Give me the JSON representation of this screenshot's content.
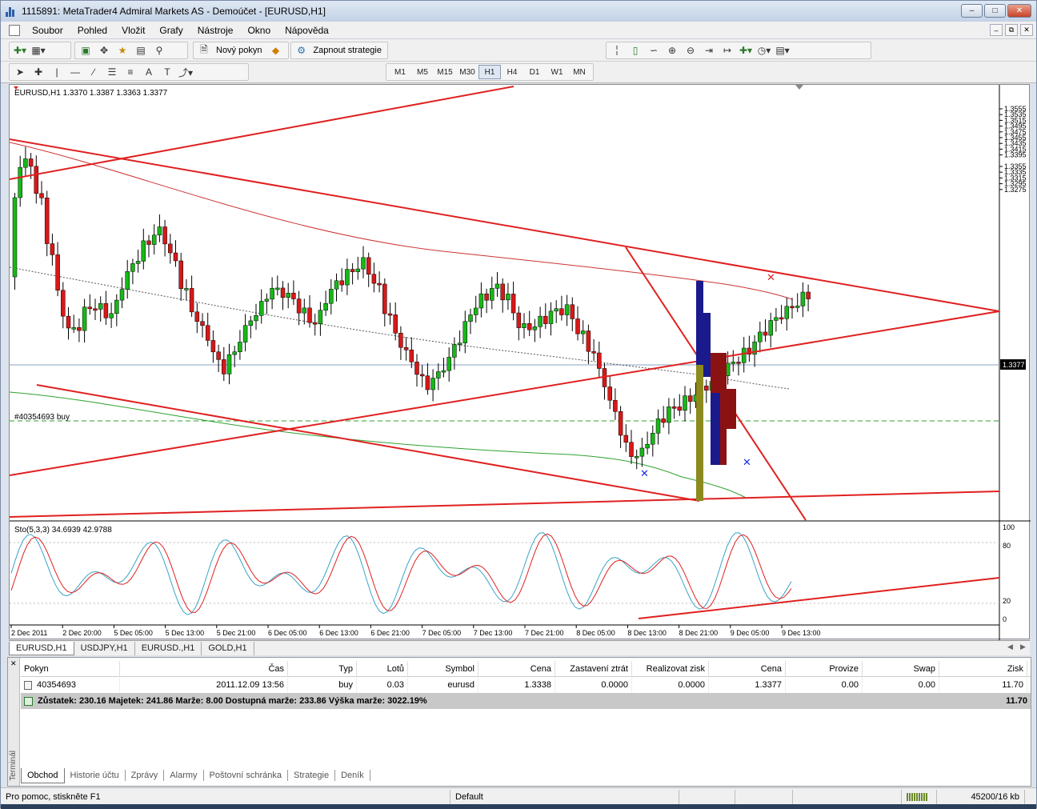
{
  "window": {
    "title": "1115891: MetaTrader4 Admiral Markets AS - Demoúčet - [EURUSD,H1]"
  },
  "menu": [
    "Soubor",
    "Pohled",
    "Vložit",
    "Grafy",
    "Nástroje",
    "Okno",
    "Nápověda"
  ],
  "toolbar": {
    "new_order": "Nový pokyn",
    "strategy": "Zapnout strategie"
  },
  "timeframes": [
    "M1",
    "M5",
    "M15",
    "M30",
    "H1",
    "H4",
    "D1",
    "W1",
    "MN"
  ],
  "timeframe_selected": "H1",
  "chart": {
    "header": "EURUSD,H1  1.3370 1.3387 1.3363 1.3377",
    "order_label": "#40354693 buy",
    "current_price": "1.3377",
    "price_ticks": [
      "1.3555",
      "1.3535",
      "1.3515",
      "1.3495",
      "1.3475",
      "1.3455",
      "1.3435",
      "1.3415",
      "1.3395",
      "1.3355",
      "1.3335",
      "1.3315",
      "1.3295",
      "1.3275"
    ],
    "stoch_header": "Sto(5,3,3) 34.6939 42.9788",
    "stoch_ticks": [
      "100",
      "80",
      "20",
      "0"
    ],
    "time_ticks": [
      "2 Dec 2011",
      "2 Dec 20:00",
      "5 Dec 05:00",
      "5 Dec 13:00",
      "5 Dec 21:00",
      "6 Dec 05:00",
      "6 Dec 13:00",
      "6 Dec 21:00",
      "7 Dec 05:00",
      "7 Dec 13:00",
      "7 Dec 21:00",
      "8 Dec 05:00",
      "8 Dec 13:00",
      "8 Dec 21:00",
      "9 Dec 05:00",
      "9 Dec 13:00"
    ]
  },
  "chart_data": {
    "type": "candlestick",
    "symbol": "EURUSD",
    "timeframe": "H1",
    "last_bar": {
      "open": 1.337,
      "high": 1.3387,
      "low": 1.3363,
      "close": 1.3377
    },
    "ylim": [
      1.327,
      1.357
    ],
    "stochastic": {
      "params": "5,3,3",
      "main": 34.6939,
      "signal": 42.9788,
      "levels": [
        20,
        80
      ],
      "ylim": [
        0,
        100
      ]
    }
  },
  "chart_tabs": [
    "EURUSD,H1",
    "USDJPY,H1",
    "EURUSD.,H1",
    "GOLD,H1"
  ],
  "terminal": {
    "columns": [
      "Pokyn",
      "Čas",
      "Typ",
      "Lotů",
      "Symbol",
      "Cena",
      "Zastavení ztrát",
      "Realizovat zisk",
      "Cena",
      "Provize",
      "Swap",
      "Zisk"
    ],
    "order": {
      "ticket": "40354693",
      "time": "2011.12.09 13:56",
      "type": "buy",
      "lots": "0.03",
      "symbol": "eurusd",
      "price": "1.3338",
      "sl": "0.0000",
      "tp": "0.0000",
      "current": "1.3377",
      "commission": "0.00",
      "swap": "0.00",
      "profit": "11.70"
    },
    "balance_line": "Zůstatek: 230.16  Majetek: 241.86  Marže: 8.00  Dostupná marže: 233.86  Výška marže: 3022.19%",
    "balance_profit": "11.70",
    "tabs": [
      "Obchod",
      "Historie účtu",
      "Zprávy",
      "Alarmy",
      "Poštovní schránka",
      "Strategie",
      "Deník"
    ],
    "side_label": "Terminál"
  },
  "status": {
    "help": "Pro pomoc, stiskněte F1",
    "profile": "Default",
    "traffic": "45200/16 kb"
  }
}
